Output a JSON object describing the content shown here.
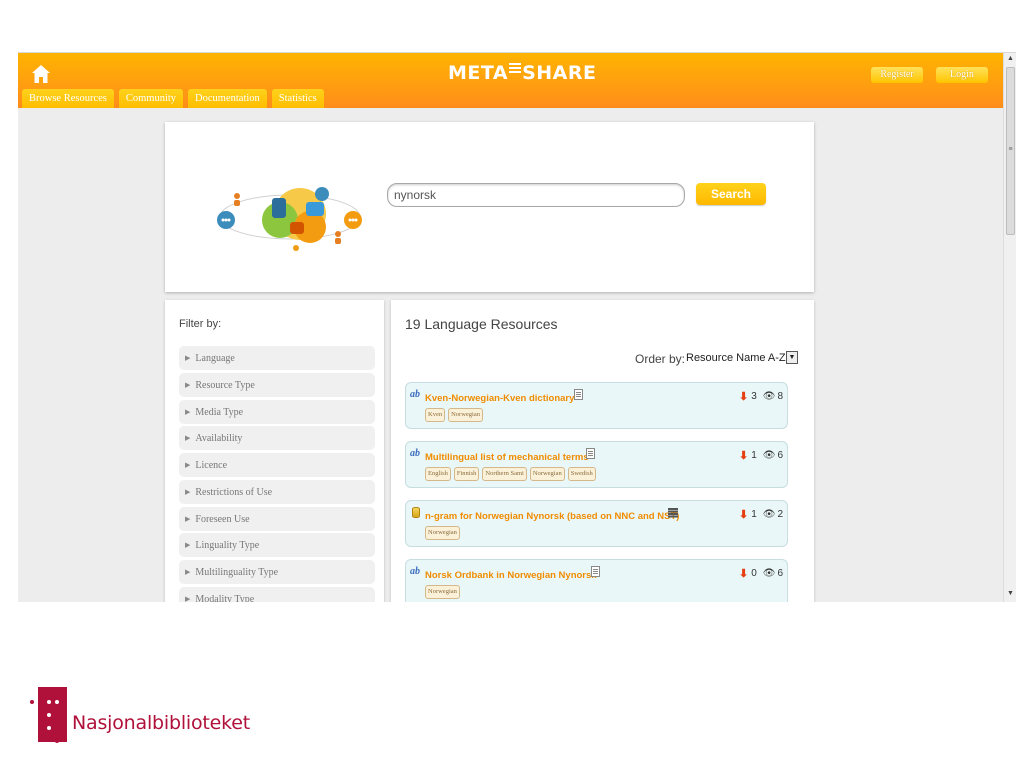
{
  "header": {
    "logo": {
      "left": "META",
      "right": "SHARE"
    },
    "register_label": "Register",
    "login_label": "Login",
    "nav_tabs": [
      "Browse Resources",
      "Community",
      "Documentation",
      "Statistics"
    ]
  },
  "search": {
    "value": "nynorsk",
    "button_label": "Search"
  },
  "filter": {
    "title": "Filter by:",
    "items": [
      "Language",
      "Resource Type",
      "Media Type",
      "Availability",
      "Licence",
      "Restrictions of Use",
      "Foreseen Use",
      "Linguality Type",
      "Multilinguality Type",
      "Modality Type"
    ]
  },
  "results": {
    "count_label": "19 Language Resources",
    "order_by_label": "Order by:",
    "order_value": "Resource Name A-Z",
    "cards": [
      {
        "type_icon": "ab",
        "title": "Kven-Norwegian-Kven dictionary",
        "icon": "document-icon",
        "tags": [
          "Kven",
          "Norwegian"
        ],
        "downloads": "3",
        "views": "8"
      },
      {
        "type_icon": "ab",
        "title": "Multilingual list of mechanical terms",
        "icon": "document-icon",
        "tags": [
          "English",
          "Finnish",
          "Northern Sami",
          "Norwegian",
          "Swedish"
        ],
        "downloads": "1",
        "views": "6"
      },
      {
        "type_icon": "database",
        "title": "n-gram for Norwegian Nynorsk (based on NNC and NST)",
        "icon": "text-icon",
        "tags": [
          "Norwegian"
        ],
        "downloads": "1",
        "views": "2"
      },
      {
        "type_icon": "ab",
        "title": "Norsk Ordbank in Norwegian Nynorsk",
        "icon": "document-icon",
        "tags": [
          "Norwegian"
        ],
        "downloads": "0",
        "views": "6"
      }
    ]
  },
  "footer_logo": {
    "text": "Nasjonalbiblioteket"
  },
  "colors": {
    "header_orange": "#ff9f10",
    "title_orange": "#f08c00",
    "card_bg": "#e9f7f8",
    "brand_red": "#b0113a"
  }
}
